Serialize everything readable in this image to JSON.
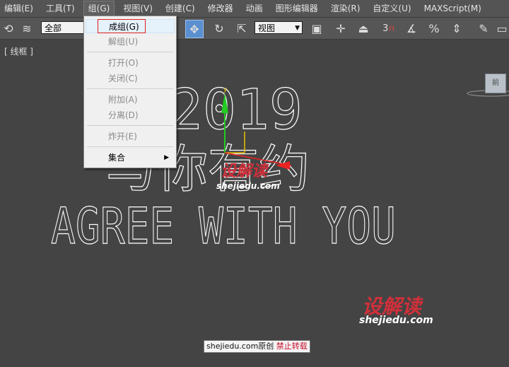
{
  "menubar": {
    "items": [
      {
        "label": "编辑(E)"
      },
      {
        "label": "工具(T)"
      },
      {
        "label": "组(G)",
        "active": true
      },
      {
        "label": "视图(V)"
      },
      {
        "label": "创建(C)"
      },
      {
        "label": "修改器"
      },
      {
        "label": "动画"
      },
      {
        "label": "图形编辑器"
      },
      {
        "label": "渲染(R)"
      },
      {
        "label": "自定义(U)"
      },
      {
        "label": "MAXScript(M)"
      }
    ]
  },
  "toolbar": {
    "selection_filter": "全部",
    "ref_coord": "视图",
    "snap_label": "3"
  },
  "group_menu": {
    "items": [
      {
        "label": "成组(G)",
        "enabled": true
      },
      {
        "label": "解组(U)",
        "enabled": false
      },
      {
        "label": "打开(O)",
        "enabled": false
      },
      {
        "label": "关闭(C)",
        "enabled": false
      },
      {
        "label": "附加(A)",
        "enabled": false
      },
      {
        "label": "分离(D)",
        "enabled": false
      },
      {
        "label": "炸开(E)",
        "enabled": false
      },
      {
        "label": "集合",
        "enabled": true
      }
    ]
  },
  "viewport": {
    "label": "[ 线框 ]",
    "text_line1": "2019",
    "text_line2": "与你有约",
    "text_line3": "AGREE WITH YOU",
    "gizmo_y": "y",
    "navcube_label": "前"
  },
  "watermark": {
    "logo_text": "设解读",
    "site": "shejiedu.com"
  },
  "footer": {
    "prefix": "shejiedu.com原创",
    "suffix": "禁止转载"
  },
  "colors": {
    "viewport_bg": "#444444",
    "wire": "#ffffff",
    "gizmo_y": "#22cc22",
    "gizmo_x": "#ee2222",
    "gizmo_z": "#e6c200",
    "highlight_border": "#e02020"
  }
}
